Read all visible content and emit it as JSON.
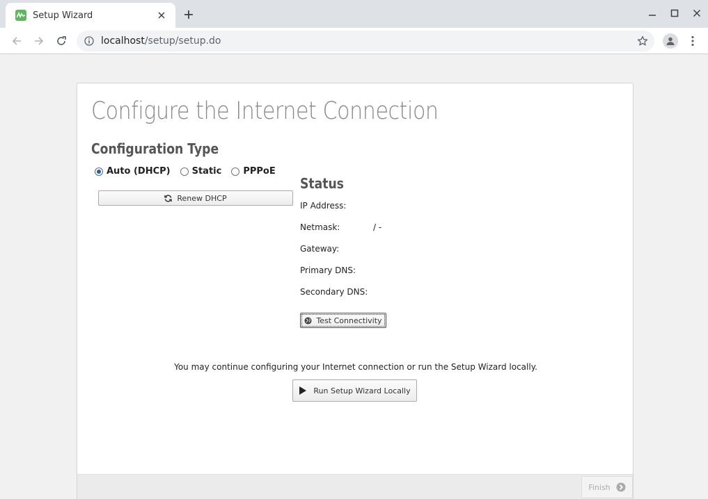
{
  "browser": {
    "tab_title": "Setup Wizard",
    "url_host": "localhost",
    "url_path": "/setup/setup.do",
    "favicon_color": "#5cb85c"
  },
  "page": {
    "title": "Configure the Internet Connection",
    "config_type_title": "Configuration Type",
    "options": [
      {
        "label": "Auto (DHCP)",
        "checked": true
      },
      {
        "label": "Static",
        "checked": false
      },
      {
        "label": "PPPoE",
        "checked": false
      }
    ],
    "renew_label": "Renew DHCP",
    "status": {
      "title": "Status",
      "ip_label": "IP Address:",
      "ip_value": "",
      "netmask_label": "Netmask:",
      "netmask_value": "/ -",
      "gateway_label": "Gateway:",
      "gateway_value": "",
      "primary_dns_label": "Primary DNS:",
      "primary_dns_value": "",
      "secondary_dns_label": "Secondary DNS:",
      "secondary_dns_value": ""
    },
    "test_label": "Test Connectivity",
    "continue_text": "You may continue configuring your Internet connection or run the Setup Wizard locally.",
    "run_label": "Run Setup Wizard Locally",
    "finish_label": "Finish"
  },
  "colors": {
    "accent": "#2a5d9f",
    "title_gray": "#888888"
  }
}
